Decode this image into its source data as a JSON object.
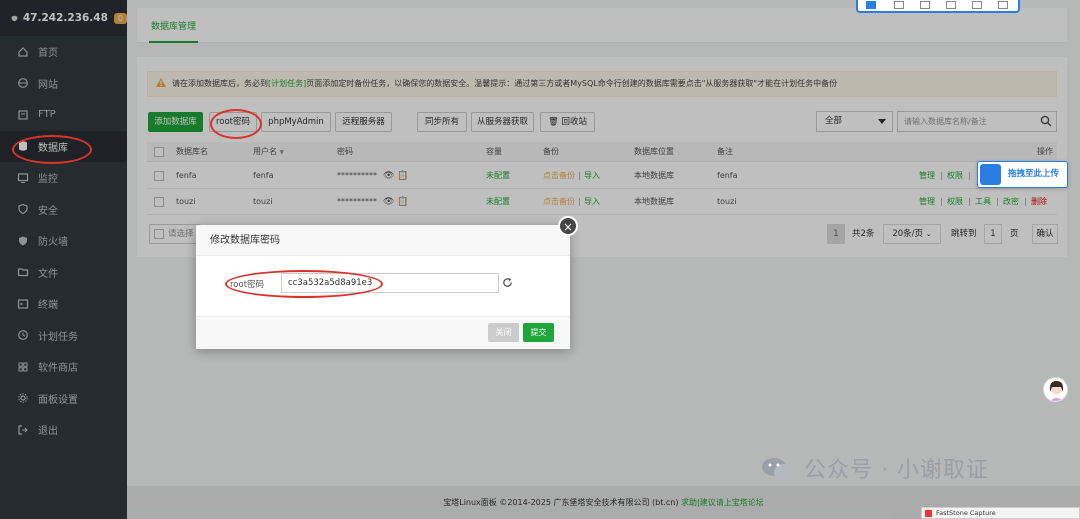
{
  "sidebar": {
    "server_ip": "47.242.236.48",
    "badge": "0",
    "items": [
      {
        "label": "首页",
        "icon": "home-icon"
      },
      {
        "label": "网站",
        "icon": "globe-icon"
      },
      {
        "label": "FTP",
        "icon": "ftp-icon"
      },
      {
        "label": "数据库",
        "icon": "database-icon"
      },
      {
        "label": "监控",
        "icon": "monitor-icon"
      },
      {
        "label": "安全",
        "icon": "shield-icon"
      },
      {
        "label": "防火墙",
        "icon": "firewall-icon"
      },
      {
        "label": "文件",
        "icon": "folder-icon"
      },
      {
        "label": "终端",
        "icon": "terminal-icon"
      },
      {
        "label": "计划任务",
        "icon": "clock-icon"
      },
      {
        "label": "软件商店",
        "icon": "grid-icon"
      },
      {
        "label": "面板设置",
        "icon": "gear-icon"
      },
      {
        "label": "退出",
        "icon": "logout-icon"
      }
    ],
    "active_index": 3
  },
  "tabs": {
    "db_manage": "数据库管理"
  },
  "alert": {
    "pre": "请在添加数据库后，务必到",
    "link": "[计划任务]",
    "post": "页面添加定时备份任务，以确保您的数据安全。温馨提示：通过第三方或者MySQL命令行创建的数据库需要点击\"从服务器获取\"才能在计划任务中备份"
  },
  "toolbar": {
    "add_db": "添加数据库",
    "root_pw": "root密码",
    "phpmyadmin": "phpMyAdmin",
    "remote_server": "远程服务器",
    "sync_all": "同步所有",
    "fetch_server": "从服务器获取",
    "recycle": "回收站",
    "filter_select": "全部",
    "search_placeholder": "请输入数据库名称/备注"
  },
  "table": {
    "headers": {
      "name": "数据库名",
      "user": "用户名",
      "password": "密码",
      "capacity": "容量",
      "backup": "备份",
      "location": "数据库位置",
      "remark": "备注",
      "ops": "操作"
    },
    "rows": [
      {
        "name": "fenfa",
        "user": "fenfa",
        "password": "**********",
        "capacity": "未配置",
        "backup_link": "点击备份",
        "import_link": "导入",
        "location": "本地数据库",
        "remark": "fenfa",
        "op_manage": "管理",
        "op_perm": "权限",
        "op_tools": "",
        "op_change": "",
        "op_delete": ""
      },
      {
        "name": "touzi",
        "user": "touzi",
        "password": "**********",
        "capacity": "未配置",
        "backup_link": "点击备份",
        "import_link": "导入",
        "location": "本地数据库",
        "remark": "touzi",
        "op_manage": "管理",
        "op_perm": "权限",
        "op_tools": "工具",
        "op_change": "改密",
        "op_delete": "删除"
      }
    ],
    "batch_select_placeholder": "请选择"
  },
  "pager": {
    "current": "1",
    "total": "共2条",
    "page_size": "20条/页",
    "jump_label": "跳转到",
    "jump_value": "1",
    "page_unit": "页",
    "confirm": "确认"
  },
  "modal": {
    "title": "修改数据库密码",
    "label": "root密码",
    "value": "cc3a532a5d8a91e3",
    "close_btn": "关闭",
    "submit_btn": "提交"
  },
  "footer": {
    "copyright": "宝塔Linux面板 ©2014-2025 广东堡塔安全技术有限公司 (bt.cn)",
    "link": "求助|建议请上宝塔论坛"
  },
  "overlays": {
    "baidu_upload": "拖拽至此上传",
    "watermark": "公众号 · 小谢取证",
    "faststone": "FastStone Capture"
  },
  "colors": {
    "brand_green": "#20a53a",
    "sidebar_bg": "#333a40",
    "highlight_red": "#d9342b"
  }
}
